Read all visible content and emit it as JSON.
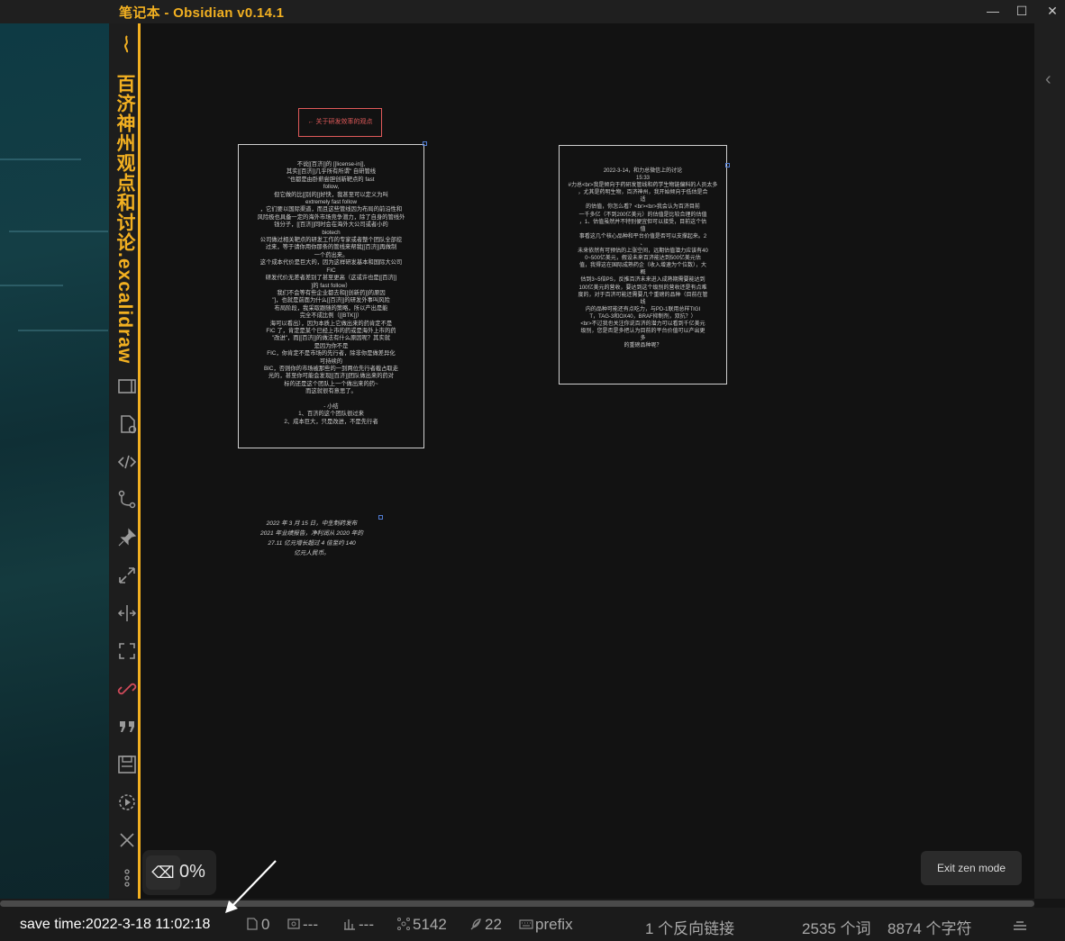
{
  "window": {
    "title": "笔记本 - Obsidian v0.14.1",
    "controls": {
      "minimize": "—",
      "maximize": "☐",
      "close": "✕"
    }
  },
  "sidebar": {
    "file_title": "百济神州观点和讨论.excalidraw",
    "icons": [
      "obsidian-logo-icon",
      "slides-icon",
      "new-file-icon",
      "code-icon",
      "graph-branch-icon",
      "pin-icon",
      "expand-icon",
      "split-horizontal-icon",
      "fullscreen-icon",
      "link-icon",
      "quote-icon",
      "save-icon",
      "settings-play-icon",
      "close-icon",
      "more-options-icon"
    ]
  },
  "canvas": {
    "red_label": "← 关于研发效率的观点",
    "left_card_text": "不说[[百济]]的 [[license-in]],\n其实[[百济]]几乎所有所谓\" 自研管线\n\"也都是由卧薪尝胆创新靶点的 fast\nfollow,\n但它做的比[[别的]]好快，我甚至可以定义为叫\nextremely fast follow\n，它们要以国际渠道，而且这些管线因为布局的前沿性和\n风险极也具备一定的海外市场竞争潜力，除了自身的管线外\n钱分子，[[百济]]同时会在海外大公司或者小的\nbiotech\n公司做过相关靶点的研发工作的专家或者整个团队全部挖\n过来，等于请你用你那条的管线来帮我[[百济]]再做制\n一个药出来。\n这个成本代价是巨大的，因为这样研发基本和国际大公司\nFIC\n研发代价无差者差别了甚至更高（这或许也是[[百济]]\n]的 fast follow）\n我们不会等有些企业都去和[[创新药]]的原因\n\"]，也就是前面为什么[[百济]]的研发外事叫风险\n布局阶段，我采取跟随的策略，所以产出是能\n完全不成比例（[[BTK]]）\n海可以看出），因为本质上它做出来的药肯定不是\nFIC 了，肯定是某个已经上市的药或是海外上市的药\n\"改进\"，而[[百济]]的做法有什么原因呢？其实就\n是因为你不是\nFIC，你肯定不是市场的先行者，除非你是做差异化\n可持续的\nBIC，否则你的市场被那些的一到两位先行者截占取走\n光的，甚至你可能会发现[[百济]]团队做出来的药对\n标的还是这个团队上一个做出来的药~\n而这就很有意思了。\n\n- 小结\n1、百济的这个团队很过来\n2、成本巨大，只是改进，不是先行者",
    "right_card_text": "2022-3-14，和力总微信上的讨论\n15:33\n#力总<br>我是倾向于药研发管线和药学生物链偏科的人员太多\n，尤其是药明生物，百济神州，我开始倾向于低估是合\n适\n的估值，你怎么看？<br><br>我会认为百济目前\n一千多亿（不到200亿美元）的估值是比较合理的估值\n，1、估值虽然并不特别便宜但可以接受，目前这个估\n值\n事看这几个核心品种和平台价值是否可以支撑起来。2\n、\n未来依然有可预估的上涨空间，远期估值潜力应该有40\n0~500亿美元，假设未来百济能达到500亿美元估\n值，我得这在国际成熟药企（收入增速为个位数），大\n概\n估到3~5倍PS，反推百济未来进入成熟期需要能达到\n100亿美元的营收，要达到这个级别的营收还是有点难\n度的，对于百济可能还需要几个重磅的品种（目前在管\n线\n内的品种可能还有点吃力，与PD-1联用总样TIGI\nT，TAG-3和OX40，BRAF抑制剂，双抗？）\n<br>不过我也关注你说百济的潜力可以看到千亿美元\n级别，您是否是多把认为目前的平台价值可以产出更\n多\n的重磅品种呢？",
    "note_text": "2022 年 3 月 15 日，中生制药发布\n2021 年业绩报告，净利润从 2020 年的\n27.11 亿元增长超过 4 倍至约 140\n亿元人民币。"
  },
  "zoom": {
    "value": "0%",
    "eraser_icon": "eraser-icon"
  },
  "exit_zen_label": "Exit zen mode",
  "statusbar": {
    "save_time": "save time:2022-3-18 11:02:18",
    "backlinks_count": "0",
    "frames": "---",
    "columns": "---",
    "nodes": "5142",
    "edges": "22",
    "keyboard_mode": "prefix",
    "backlinks_text": "1 个反向链接",
    "words": "2535 个词",
    "chars": "8874 个字符"
  },
  "colors": {
    "accent": "#f2b021",
    "canvas_bg": "#121212",
    "label_red": "#e05a5a"
  }
}
